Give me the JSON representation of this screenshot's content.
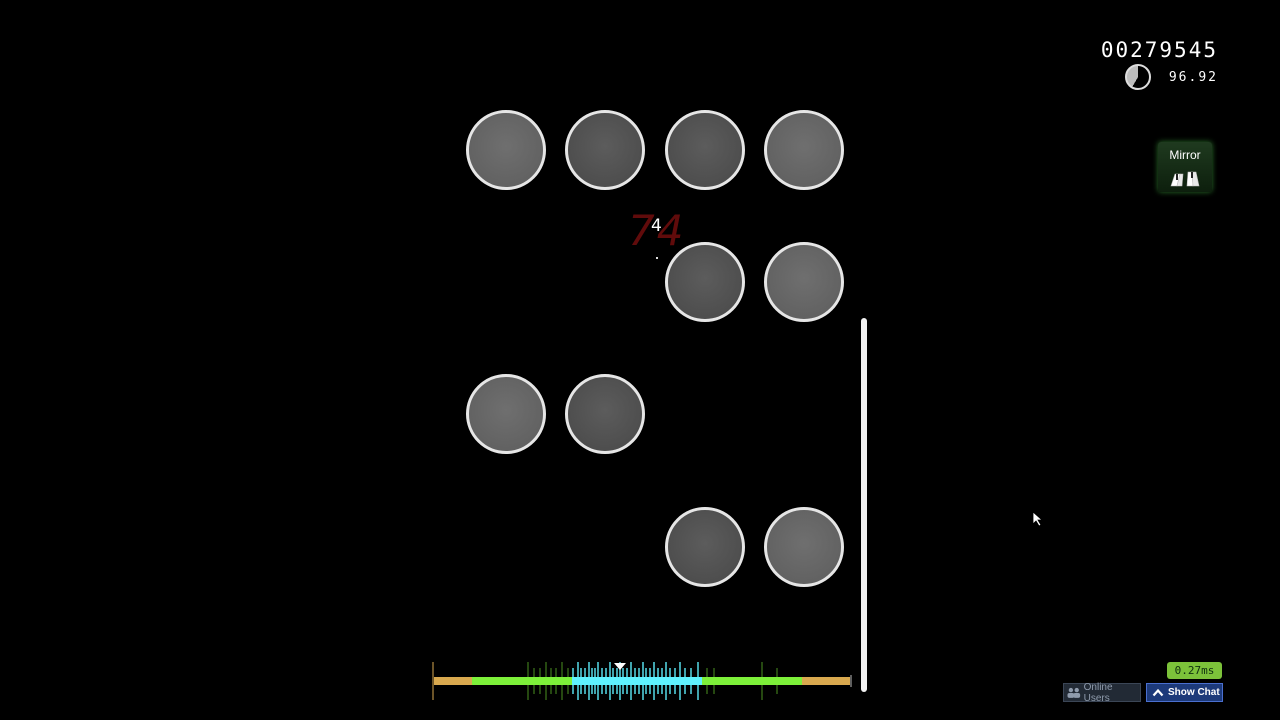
{
  "hud": {
    "score": "00279545",
    "accuracy": "96.92",
    "combo": "4",
    "combo_ghost": "74",
    "latency": "0.27ms",
    "online_users_label": "Online Users",
    "show_chat_label": "Show Chat"
  },
  "mod": {
    "label": "Mirror",
    "icon": "mirror-keys-icon"
  },
  "playfield": {
    "key_count": 4,
    "notes": [
      {
        "column": 1,
        "row": 1,
        "shade": "light"
      },
      {
        "column": 2,
        "row": 1,
        "shade": "dark"
      },
      {
        "column": 3,
        "row": 1,
        "shade": "dark"
      },
      {
        "column": 4,
        "row": 1,
        "shade": "light"
      },
      {
        "column": 3,
        "row": 2,
        "shade": "dark"
      },
      {
        "column": 4,
        "row": 2,
        "shade": "light"
      },
      {
        "column": 1,
        "row": 3,
        "shade": "light"
      },
      {
        "column": 2,
        "row": 3,
        "shade": "dark"
      },
      {
        "column": 3,
        "row": 4,
        "shade": "dark"
      },
      {
        "column": 4,
        "row": 4,
        "shade": "light"
      }
    ]
  },
  "colors": {
    "background": "#000000",
    "note_border": "#e6e6e6",
    "hit_perfect": "#5ff2ff",
    "hit_great": "#7df03a",
    "hit_good": "#d9a94f",
    "latency_badge": "#7cc23a",
    "show_chat_bg": "#1d3a7a"
  }
}
